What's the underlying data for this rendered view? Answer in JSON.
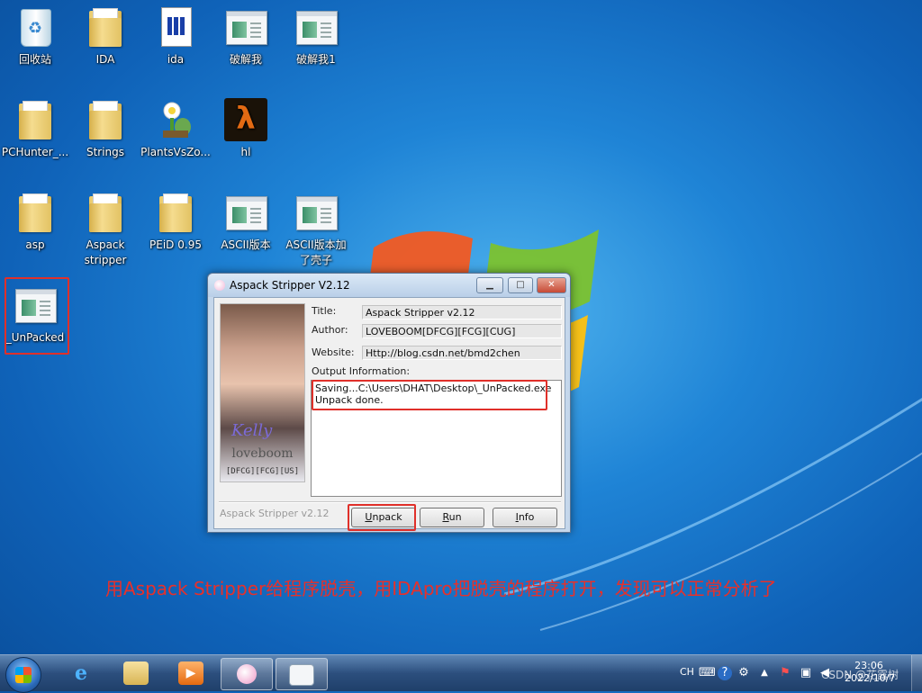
{
  "desktop": {
    "icons": [
      {
        "label": "回收站",
        "kind": "recycle-bin"
      },
      {
        "label": "IDA",
        "kind": "folder"
      },
      {
        "label": "ida",
        "kind": "shortcut"
      },
      {
        "label": "破解我",
        "kind": "exe"
      },
      {
        "label": "破解我1",
        "kind": "exe"
      },
      {
        "label": "PCHunter_...",
        "kind": "folder"
      },
      {
        "label": "Strings",
        "kind": "folder"
      },
      {
        "label": "PlantsVsZo...",
        "kind": "game"
      },
      {
        "label": "hl",
        "kind": "game"
      },
      {
        "label": "asp",
        "kind": "folder"
      },
      {
        "label": "Aspack\nstripper",
        "kind": "folder"
      },
      {
        "label": "PEiD 0.95",
        "kind": "folder"
      },
      {
        "label": "ASCII版本",
        "kind": "exe"
      },
      {
        "label": "ASCII版本加\n了壳子",
        "kind": "exe"
      },
      {
        "label": "_UnPacked",
        "kind": "exe"
      }
    ]
  },
  "dialog": {
    "title": "Aspack Stripper V2.12",
    "photo_signature": "Kelly",
    "photo_name": "loveboom",
    "photo_groups": "[DFCG][FCG][US]",
    "fields": {
      "title_label": "Title:",
      "title_value": "Aspack Stripper v2.12",
      "author_label": "Author:",
      "author_value": "LOVEBOOM[DFCG][FCG][CUG]",
      "website_label": "Website:",
      "website_value": "Http://blog.csdn.net/bmd2chen"
    },
    "output_label": "Output Information:",
    "output_lines": [
      "Saving...C:\\Users\\DHAT\\Desktop\\_UnPacked.exe",
      "Unpack done."
    ],
    "version_text": "Aspack Stripper v2.12",
    "buttons": {
      "unpack": {
        "accel": "U",
        "rest": "npack"
      },
      "run": {
        "accel": "R",
        "rest": "un"
      },
      "info": {
        "accel": "I",
        "rest": "nfo"
      }
    }
  },
  "caption": "用Aspack Stripper给程序脱壳，用IDApro把脱壳的程序打开，发现可以正常分析了",
  "taskbar": {
    "language": "CH",
    "time": "23:06",
    "date": "2022/10/7",
    "watermark": "CSDN @花露树"
  },
  "colors": {
    "highlight_red": "#e0302a",
    "caption_red": "#e8302a"
  }
}
